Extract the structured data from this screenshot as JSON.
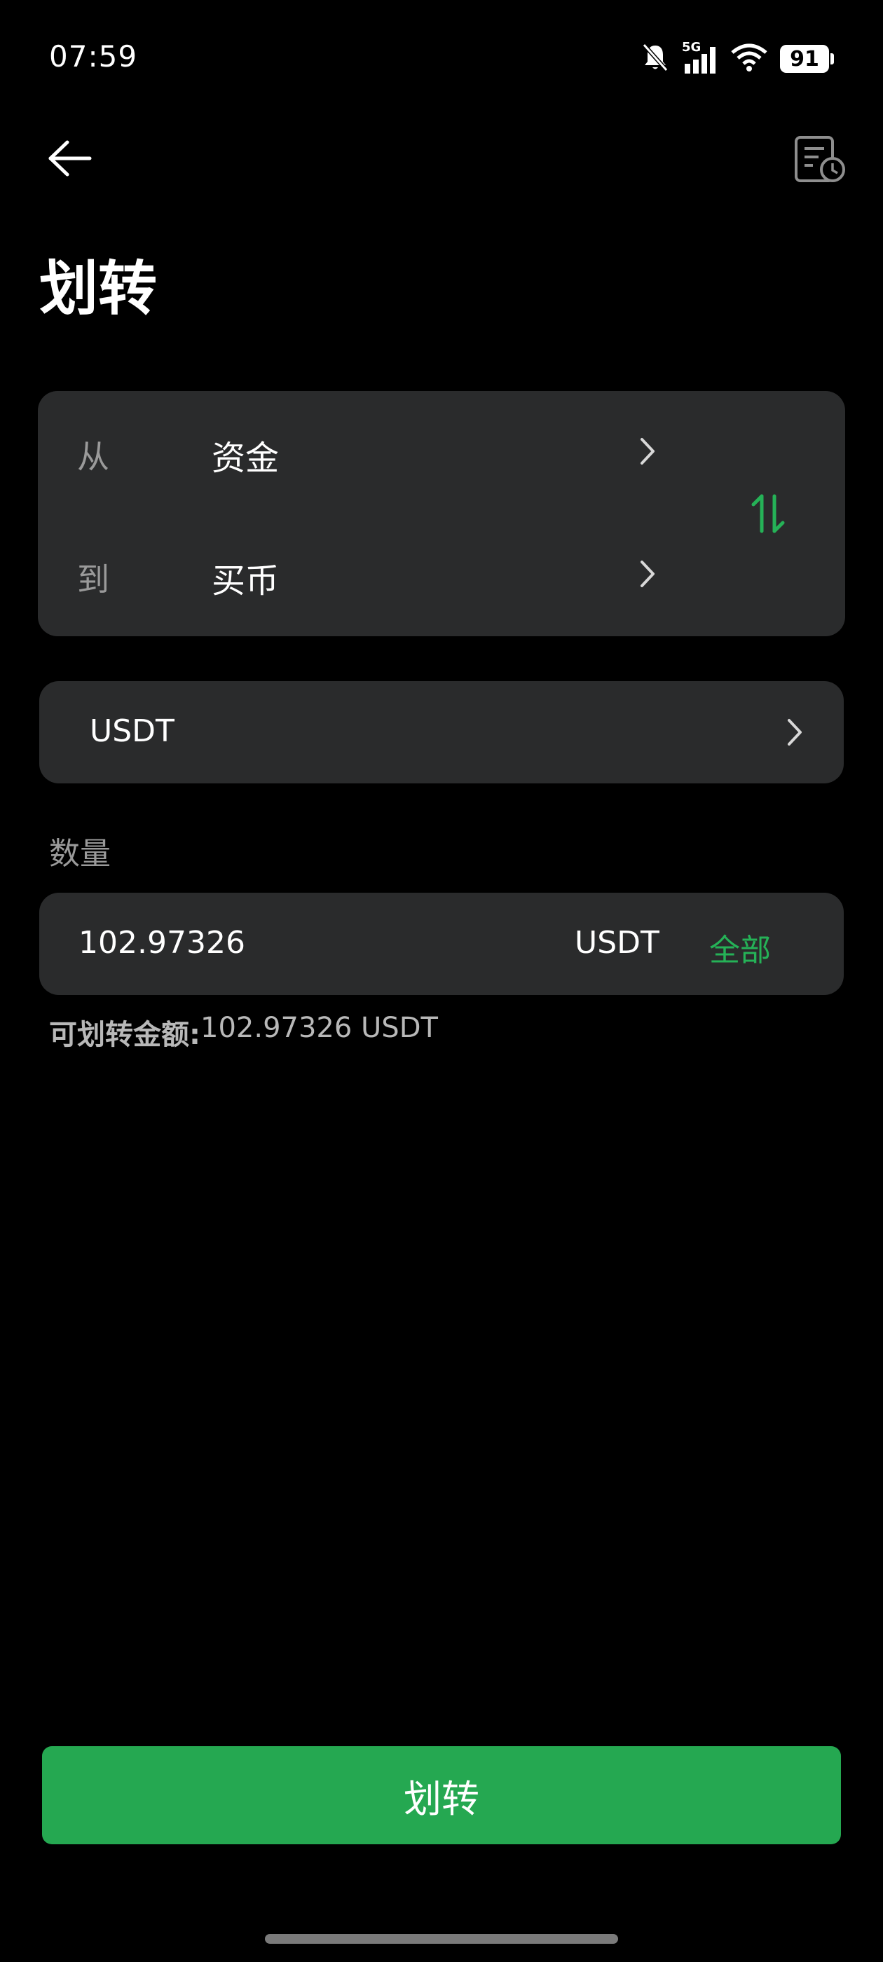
{
  "status_bar": {
    "time": "07:59",
    "network": "5G",
    "battery": "91",
    "icons": [
      "bell-muted-icon",
      "signal-icon",
      "wifi-icon",
      "battery-icon"
    ]
  },
  "header": {
    "back_icon": "arrow-left-icon",
    "history_icon": "document-clock-icon",
    "title": "划转"
  },
  "transfer": {
    "from_label": "从",
    "from_value": "资金",
    "to_label": "到",
    "to_value": "买币",
    "swap_icon": "swap-vertical-icon"
  },
  "coin": {
    "selected": "USDT"
  },
  "quantity": {
    "label": "数量",
    "value": "102.97326",
    "unit": "USDT",
    "all_label": "全部"
  },
  "available": {
    "label": "可划转金额:",
    "amount": "102.97326 USDT"
  },
  "submit": {
    "label": "划转"
  },
  "colors": {
    "background": "#000000",
    "card": "#2a2b2c",
    "accent_green": "#25a851",
    "muted_text": "#9a9a9a"
  }
}
